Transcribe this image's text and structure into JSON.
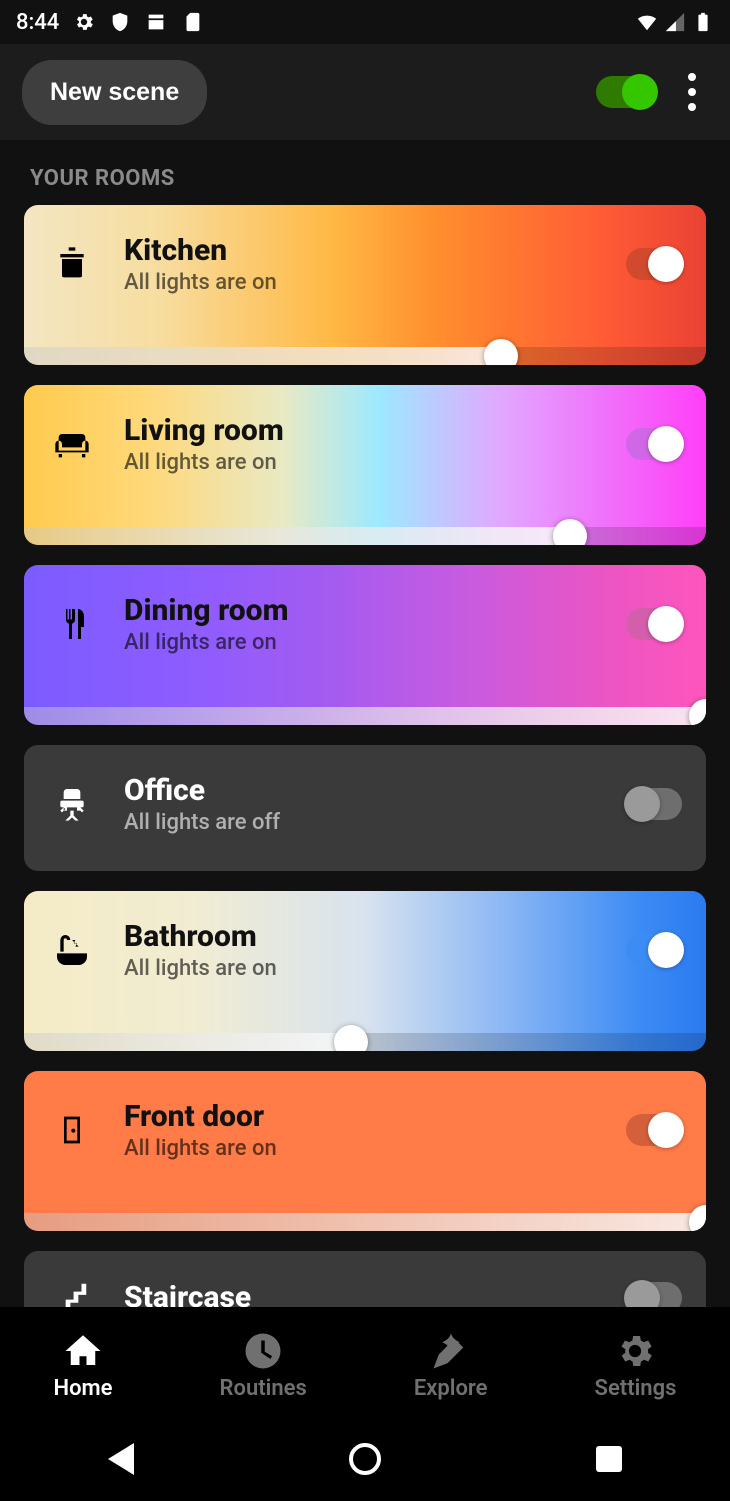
{
  "status_bar": {
    "time": "8:44"
  },
  "appbar": {
    "new_scene_label": "New scene",
    "master_on": true
  },
  "section_title": "YOUR ROOMS",
  "rooms": [
    {
      "id": "kitchen",
      "name": "Kitchen",
      "status": "All lights are on",
      "on": true,
      "brightness": 70,
      "dark_text": true,
      "bg": "bg-kitchen",
      "toggle_track": "#d14a2e",
      "icon": "pot"
    },
    {
      "id": "living",
      "name": "Living room",
      "status": "All lights are on",
      "on": true,
      "brightness": 80,
      "dark_text": true,
      "bg": "bg-living",
      "toggle_track": "#d067e6",
      "icon": "sofa"
    },
    {
      "id": "dining",
      "name": "Dining room",
      "status": "All lights are on",
      "on": true,
      "brightness": 100,
      "dark_text": true,
      "bg": "bg-dining",
      "toggle_track": "#d35fac",
      "icon": "cutlery"
    },
    {
      "id": "office",
      "name": "Office",
      "status": "All lights are off",
      "on": false,
      "brightness": null,
      "dark_text": false,
      "bg": "bg-office",
      "toggle_track": "#6e6e6e",
      "icon": "chair"
    },
    {
      "id": "bath",
      "name": "Bathroom",
      "status": "All lights are on",
      "on": true,
      "brightness": 48,
      "dark_text": true,
      "bg": "bg-bath",
      "toggle_track": "#3b8cf4",
      "icon": "bath"
    },
    {
      "id": "door",
      "name": "Front door",
      "status": "All lights are on",
      "on": true,
      "brightness": 100,
      "dark_text": true,
      "bg": "bg-door",
      "toggle_track": "#d3603a",
      "icon": "door"
    },
    {
      "id": "stairs",
      "name": "Staircase",
      "status": "",
      "on": false,
      "brightness": null,
      "dark_text": false,
      "bg": "bg-stairs",
      "toggle_track": "#6e6e6e",
      "icon": "stairs"
    }
  ],
  "tabs": [
    {
      "id": "home",
      "label": "Home",
      "active": true
    },
    {
      "id": "routines",
      "label": "Routines",
      "active": false
    },
    {
      "id": "explore",
      "label": "Explore",
      "active": false
    },
    {
      "id": "settings",
      "label": "Settings",
      "active": false
    }
  ]
}
